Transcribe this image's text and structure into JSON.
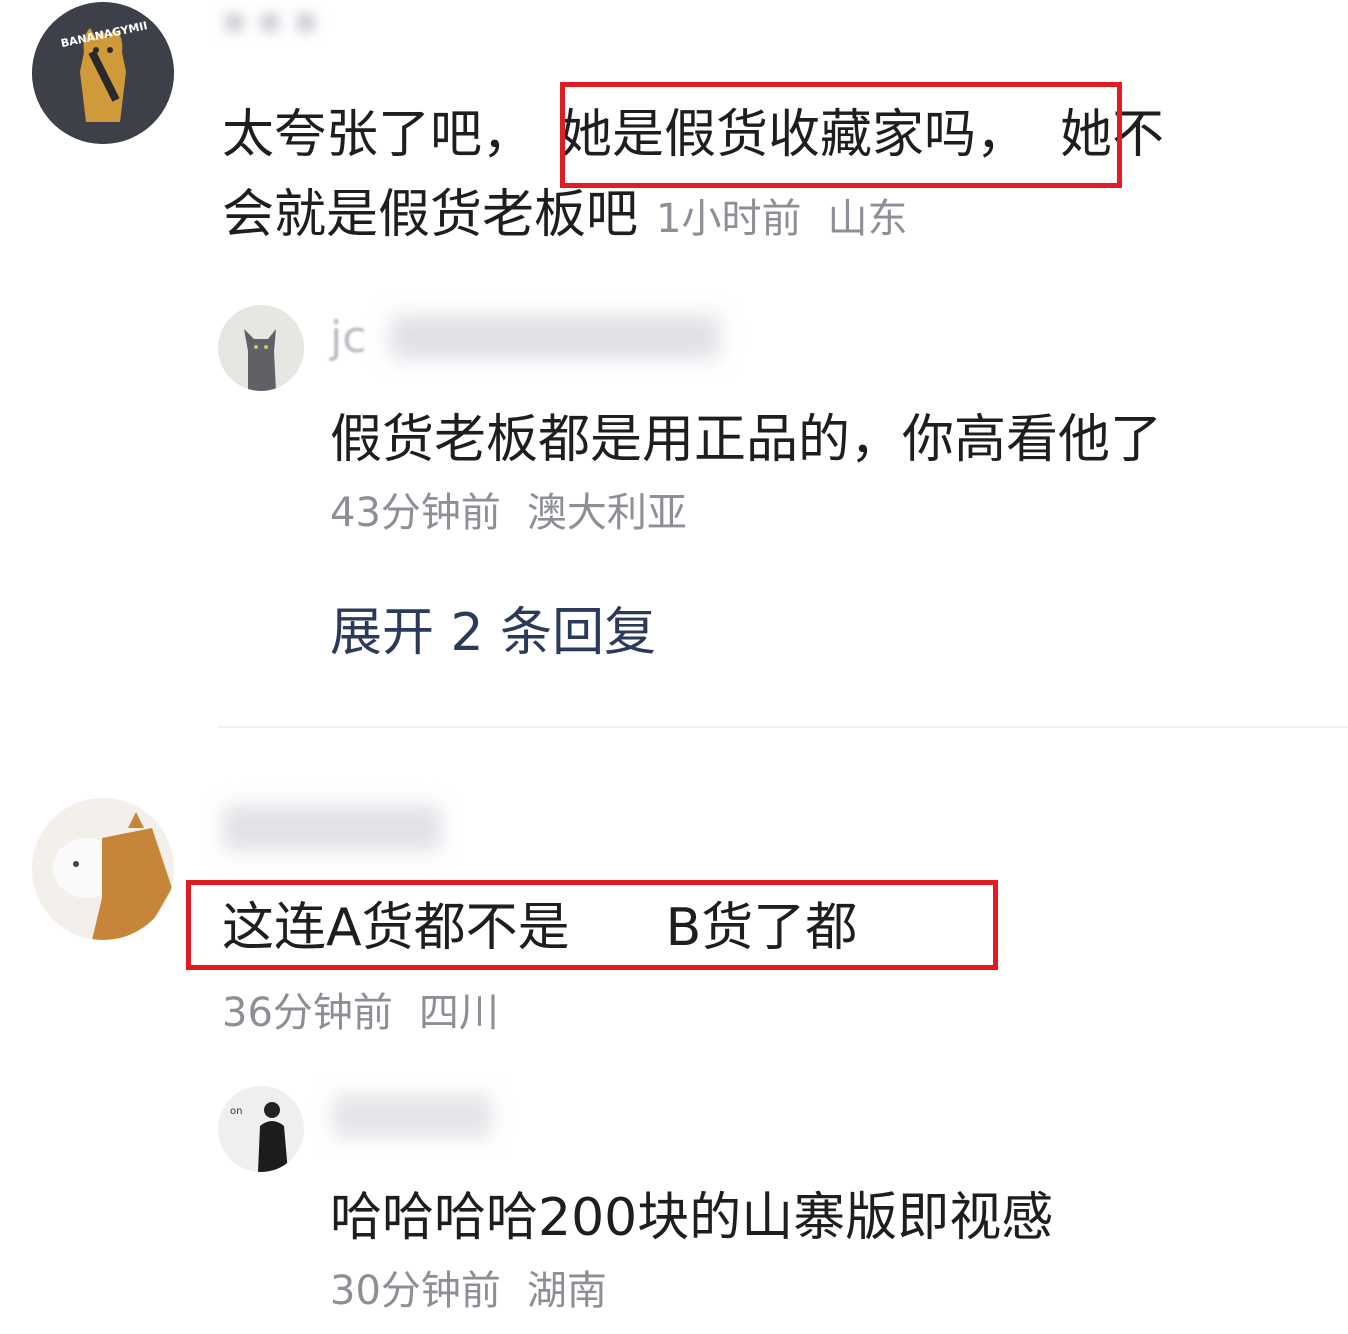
{
  "comments": [
    {
      "body_part1": "太夸张了吧，",
      "body_highlight": "她是假货收藏家吗，",
      "body_part2": "她不",
      "body_line2": "会就是假货老板吧",
      "time": "1小时前",
      "location": "山东",
      "avatar_text": "BANANAGYMII",
      "reply": {
        "username": "jc",
        "body": "假货老板都是用正品的，你高看他了",
        "time": "43分钟前",
        "location": "澳大利亚"
      },
      "expand_label": "展开 2 条回复"
    },
    {
      "body_highlight_a": "这连A货都不是",
      "body_highlight_b": "B货了都",
      "time": "36分钟前",
      "location": "四川",
      "reply": {
        "body": "哈哈哈哈200块的山寨版即视感",
        "time": "30分钟前",
        "location": "湖南"
      }
    }
  ],
  "colors": {
    "highlight_border": "#e31b23",
    "meta_text": "#8c8f96",
    "expand_text": "#2a3a5a"
  }
}
